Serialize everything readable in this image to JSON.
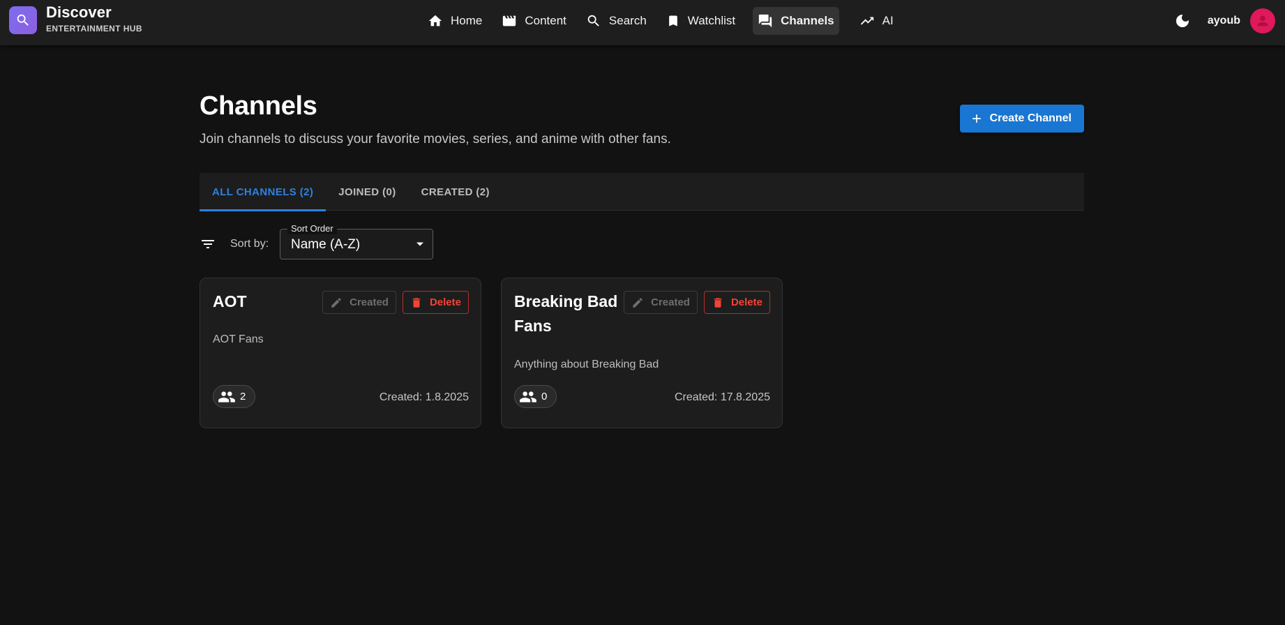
{
  "brand": {
    "title": "Discover",
    "subtitle": "ENTERTAINMENT HUB",
    "logo_icon": "search-icon",
    "logo_color": "#7c6cf0"
  },
  "nav": {
    "items": [
      {
        "label": "Home",
        "icon": "home-icon"
      },
      {
        "label": "Content",
        "icon": "clapperboard-icon"
      },
      {
        "label": "Search",
        "icon": "search-icon"
      },
      {
        "label": "Watchlist",
        "icon": "bookmark-icon"
      },
      {
        "label": "Channels",
        "icon": "forum-icon",
        "active": true
      },
      {
        "label": "AI",
        "icon": "trending-up-icon"
      }
    ]
  },
  "user": {
    "name": "ayoub",
    "theme_icon": "moon-icon",
    "avatar_color": "#e0185c"
  },
  "page": {
    "title": "Channels",
    "subtitle": "Join channels to discuss your favorite movies, series, and anime with other fans.",
    "create_label": "Create Channel"
  },
  "tabs": [
    {
      "label": "ALL CHANNELS (2)",
      "active": true
    },
    {
      "label": "JOINED (0)"
    },
    {
      "label": "CREATED (2)"
    }
  ],
  "sort": {
    "label": "Sort by:",
    "legend": "Sort Order",
    "value": "Name (A-Z)"
  },
  "cards": [
    {
      "title": "AOT",
      "created_chip": "Created",
      "delete_label": "Delete",
      "description": "AOT Fans",
      "members": "2",
      "created": "Created: 1.8.2025"
    },
    {
      "title": "Breaking Bad Fans",
      "created_chip": "Created",
      "delete_label": "Delete",
      "description": "Anything about Breaking Bad",
      "members": "0",
      "created": "Created: 17.8.2025"
    }
  ],
  "colors": {
    "accent": "#1976d2",
    "tab_active": "#2f80e0",
    "danger": "#f44336",
    "background": "#121212",
    "surface": "#1d1d1d"
  }
}
